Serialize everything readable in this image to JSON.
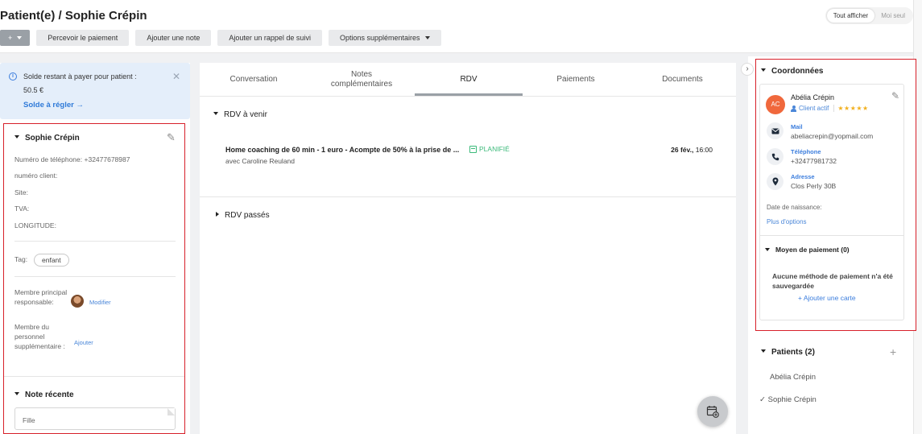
{
  "header": {
    "title": "Patient(e) / Sophie Crépin",
    "toolbar": {
      "plus_label": "+",
      "payment_label": "Percevoir le paiement",
      "note_label": "Ajouter une note",
      "reminder_label": "Ajouter un rappel de suivi",
      "options_label": "Options supplémentaires"
    },
    "view_toggle": [
      "Tout afficher",
      "Moi seul"
    ]
  },
  "balance": {
    "label": "Solde restant à payer pour patient :",
    "amount": "50.5 €",
    "link": "Solde à régler",
    "link_arrow": "→"
  },
  "patient": {
    "name": "Sophie Crépin",
    "fields": [
      {
        "label": "Numéro de téléphone:",
        "value": "+32477678987"
      },
      {
        "label": "numéro client:",
        "value": ""
      },
      {
        "label": "Site:",
        "value": ""
      },
      {
        "label": "TVA:",
        "value": ""
      },
      {
        "label": "LONGITUDE:",
        "value": ""
      }
    ],
    "tag_label": "Tag:",
    "tag_value": "enfant",
    "main_member_label": "Membre principal responsable:",
    "modify_link": "Modifier",
    "extra_staff_label": "Membre du personnel supplémentaire :",
    "add_link": "Ajouter"
  },
  "note": {
    "heading": "Note récente",
    "placeholder": "Fille"
  },
  "tabs": [
    {
      "label": "Conversation"
    },
    {
      "label": "Notes complémentaires"
    },
    {
      "label": "RDV"
    },
    {
      "label": "Paiements"
    },
    {
      "label": "Documents"
    }
  ],
  "appointments": {
    "upcoming_heading": "RDV à venir",
    "items": [
      {
        "title": "Home coaching de 60 min - 1 euro - Acompte de 50% à la prise de ...",
        "status": "PLANIFIÉ",
        "with": "avec Caroline Reuland",
        "date": "26 fév.,",
        "time": "16:00"
      }
    ],
    "past_heading": "RDV passés"
  },
  "contact": {
    "heading": "Coordonnées",
    "initials": "AC",
    "name": "Abélia Crépin",
    "status": "Client actif",
    "stars": "★★★★★",
    "mail_label": "Mail",
    "mail": "abeliacrepin@yopmail.com",
    "phone_label": "Téléphone",
    "phone": "+32477981732",
    "address_label": "Adresse",
    "address": "Clos Perly 30B",
    "dob_label": "Date de naissance:",
    "more_options": "Plus d'options",
    "payment_heading": "Moyen de paiement (0)",
    "payment_empty": "Aucune méthode de paiement n'a été sauvegardée",
    "add_card": "+ Ajouter une carte"
  },
  "patients": {
    "heading": "Patients (2)",
    "items": [
      {
        "name": "Abélia Crépin",
        "selected": false
      },
      {
        "name": "Sophie Crépin",
        "selected": true
      }
    ]
  }
}
